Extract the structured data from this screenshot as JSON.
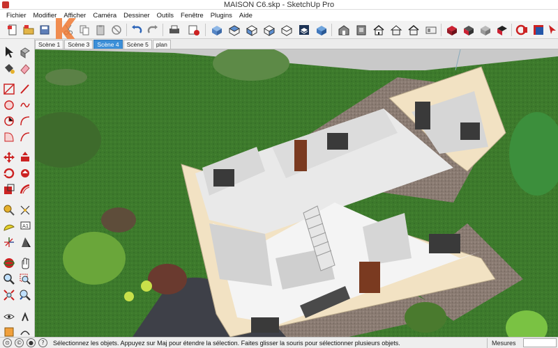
{
  "window": {
    "title": "MAISON C6.skp - SketchUp Pro"
  },
  "menu": {
    "items": [
      "Fichier",
      "Modifier",
      "Afficher",
      "Caméra",
      "Dessiner",
      "Outils",
      "Fenêtre",
      "Plugins",
      "Aide"
    ]
  },
  "toolbar": {
    "icons": [
      "new-file-icon",
      "open-file-icon",
      "save-icon",
      "cut-icon",
      "copy-icon",
      "paste-icon",
      "erase-icon",
      "undo-icon",
      "redo-icon",
      "print-icon",
      "model-info-icon",
      "iso-view-icon",
      "top-view-icon",
      "front-view-icon",
      "right-view-icon",
      "back-view-icon",
      "left-view-icon",
      "xray-style-icon",
      "wireframe-style-icon",
      "hidden-line-style-icon",
      "shaded-style-icon",
      "shaded-texture-style-icon",
      "monochrome-style-icon",
      "warehouse-icon",
      "share-model-icon",
      "extension-warehouse-icon",
      "layout-icon"
    ]
  },
  "scenes": {
    "tabs": [
      "Scène 1",
      "Scène 3",
      "Scène 4",
      "Scène 5",
      "plan"
    ],
    "active": "Scène 4"
  },
  "palette": {
    "tools": [
      "select-icon",
      "component-icon",
      "paint-bucket-icon",
      "eraser-icon",
      "line-icon",
      "freehand-icon",
      "rectangle-icon",
      "rotated-rectangle-icon",
      "circle-icon",
      "polygon-icon",
      "arc-icon",
      "two-point-arc-icon",
      "pie-icon",
      "three-point-arc-icon",
      "move-icon",
      "push-pull-icon",
      "rotate-icon",
      "follow-me-icon",
      "scale-icon",
      "offset-icon",
      "tape-measure-icon",
      "dimension-icon",
      "protractor-icon",
      "text-icon",
      "axes-icon",
      "3d-text-icon",
      "orbit-icon",
      "pan-icon",
      "zoom-icon",
      "zoom-window-icon",
      "zoom-extents-icon",
      "previous-view-icon",
      "position-camera-icon",
      "walk-icon",
      "look-around-icon",
      "section-plane-icon"
    ]
  },
  "status": {
    "message": "Sélectionnez les objets. Appuyez sur Maj pour étendre la sélection. Faites glisser la souris pour sélectionner plusieurs objets.",
    "measure_label": "Mesures",
    "measure_value": ""
  },
  "colors": {
    "active_tab": "#3c8fd8",
    "grass": "#3d7a2c",
    "wall_exterior": "#f2e2c3",
    "gravel": "#8a7b72",
    "path": "#3e4048"
  }
}
